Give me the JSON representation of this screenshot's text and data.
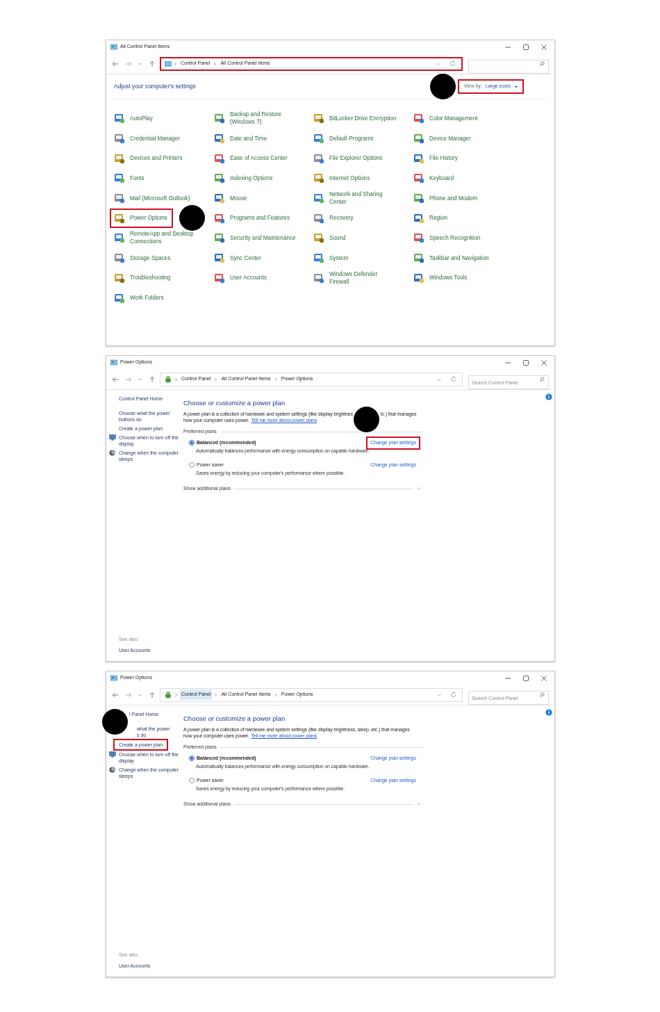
{
  "windows": [
    {
      "kind": "control_panel",
      "title": "All Control Panel Items",
      "breadcrumb": [
        {
          "label": "Control Panel",
          "hovered": false
        },
        {
          "label": "All Control Panel Items",
          "hovered": false
        }
      ],
      "address_highlighted": true,
      "heading": "Adjust your computer's settings",
      "view_by": {
        "label": "View by:",
        "value": "Large icons",
        "highlighted": true,
        "marker": true
      },
      "items": [
        {
          "label": "AutoPlay",
          "highlighted": false,
          "marker": false
        },
        {
          "label": "Backup and Restore\n(Windows 7)",
          "highlighted": false,
          "marker": false
        },
        {
          "label": "BitLocker Drive Encryption",
          "highlighted": false,
          "marker": false
        },
        {
          "label": "Color Management",
          "highlighted": false,
          "marker": false
        },
        {
          "label": "Credential Manager",
          "highlighted": false,
          "marker": false
        },
        {
          "label": "Date and Time",
          "highlighted": false,
          "marker": false
        },
        {
          "label": "Default Programs",
          "highlighted": false,
          "marker": false
        },
        {
          "label": "Device Manager",
          "highlighted": false,
          "marker": false
        },
        {
          "label": "Devices and Printers",
          "highlighted": false,
          "marker": false
        },
        {
          "label": "Ease of Access Center",
          "highlighted": false,
          "marker": false
        },
        {
          "label": "File Explorer Options",
          "highlighted": false,
          "marker": false
        },
        {
          "label": "File History",
          "highlighted": false,
          "marker": false
        },
        {
          "label": "Fonts",
          "highlighted": false,
          "marker": false
        },
        {
          "label": "Indexing Options",
          "highlighted": false,
          "marker": false
        },
        {
          "label": "Internet Options",
          "highlighted": false,
          "marker": false
        },
        {
          "label": "Keyboard",
          "highlighted": false,
          "marker": false
        },
        {
          "label": "Mail (Microsoft Outlook)",
          "highlighted": false,
          "marker": false
        },
        {
          "label": "Mouse",
          "highlighted": false,
          "marker": false
        },
        {
          "label": "Network and Sharing\nCenter",
          "highlighted": false,
          "marker": false
        },
        {
          "label": "Phone and Modem",
          "highlighted": false,
          "marker": false
        },
        {
          "label": "Power Options",
          "highlighted": true,
          "marker": true
        },
        {
          "label": "Programs and Features",
          "highlighted": false,
          "marker": false
        },
        {
          "label": "Recovery",
          "highlighted": false,
          "marker": false
        },
        {
          "label": "Region",
          "highlighted": false,
          "marker": false
        },
        {
          "label": "RemoteApp and Desktop\nConnections",
          "highlighted": false,
          "marker": false
        },
        {
          "label": "Security and Maintenance",
          "highlighted": false,
          "marker": false
        },
        {
          "label": "Sound",
          "highlighted": false,
          "marker": false
        },
        {
          "label": "Speech Recognition",
          "highlighted": false,
          "marker": false
        },
        {
          "label": "Storage Spaces",
          "highlighted": false,
          "marker": false
        },
        {
          "label": "Sync Center",
          "highlighted": false,
          "marker": false
        },
        {
          "label": "System",
          "highlighted": false,
          "marker": false
        },
        {
          "label": "Taskbar and Navigation",
          "highlighted": false,
          "marker": false
        },
        {
          "label": "Troubleshooting",
          "highlighted": false,
          "marker": false
        },
        {
          "label": "User Accounts",
          "highlighted": false,
          "marker": false
        },
        {
          "label": "Windows Defender\nFirewall",
          "highlighted": false,
          "marker": false
        },
        {
          "label": "Windows Tools",
          "highlighted": false,
          "marker": false
        },
        {
          "label": "Work Folders",
          "highlighted": false,
          "marker": false
        }
      ]
    },
    {
      "kind": "power_options",
      "title": "Power Options",
      "breadcrumb": [
        {
          "label": "Control Panel",
          "hovered": false
        },
        {
          "label": "All Control Panel Items",
          "hovered": false
        },
        {
          "label": "Power Options",
          "hovered": false
        }
      ],
      "address_highlighted": false,
      "search_placeholder": "Search Control Panel",
      "sidebar": [
        {
          "label": "Control Panel Home",
          "highlighted": false,
          "marker": false
        },
        {
          "label": "Choose what the power\nbuttons do",
          "highlighted": false,
          "marker": false
        },
        {
          "label": "Create a power plan",
          "highlighted": false,
          "marker": false
        },
        {
          "label": "Choose when to turn off the\ndisplay",
          "highlighted": false,
          "marker": false
        },
        {
          "label": "Change when the computer\nsleeps",
          "highlighted": false,
          "marker": false
        }
      ],
      "heading": "Choose or customize a power plan",
      "description": [
        [
          "A power plan is a collection of hardware and system settings (like display brightnes",
          "tc.) that manages"
        ],
        [
          "how your computer uses power."
        ]
      ],
      "description_link": "Tell me more about power plans",
      "section_label": "Preferred plans",
      "plans": [
        {
          "name": "Balanced (recommended)",
          "selected": true,
          "summary": "Automatically balances performance with energy consumption on capable hardware.",
          "action": "Change plan settings",
          "highlighted": true,
          "marker": true
        },
        {
          "name": "Power saver",
          "selected": false,
          "summary": "Saves energy by reducing your computer's performance where possible.",
          "action": "Change plan settings",
          "highlighted": false,
          "marker": false
        }
      ],
      "more_plans": "Show additional plans",
      "see_also": "See also",
      "see_also_link": "User Accounts"
    },
    {
      "kind": "power_options",
      "title": "Power Options",
      "breadcrumb": [
        {
          "label": "Control Panel",
          "hovered": true
        },
        {
          "label": "All Control Panel Items",
          "hovered": false
        },
        {
          "label": "Power Options",
          "hovered": false
        }
      ],
      "address_highlighted": false,
      "search_placeholder": "Search Control Panel",
      "sidebar": [
        {
          "label": "l Panel Home",
          "highlighted": false,
          "marker": true
        },
        {
          "label": "what the power\ns do",
          "highlighted": false,
          "marker": false
        },
        {
          "label": "Create a power plan",
          "highlighted": true,
          "marker": false
        },
        {
          "label": "Choose when to turn off the\ndisplay",
          "highlighted": false,
          "marker": false
        },
        {
          "label": "Change when the computer\nsleeps",
          "highlighted": false,
          "marker": false
        }
      ],
      "heading": "Choose or customize a power plan",
      "description": [
        [
          "A power plan is a collection of hardware and system settings (like display brightness, sleep, etc.) that manages"
        ],
        [
          "how your computer uses power."
        ]
      ],
      "description_link": "Tell me more about power plans",
      "section_label": "Preferred plans",
      "plans": [
        {
          "name": "Balanced (recommended)",
          "selected": true,
          "summary": "Automatically balances performance with energy consumption on capable hardware.",
          "action": "Change plan settings",
          "highlighted": false,
          "marker": false
        },
        {
          "name": "Power saver",
          "selected": false,
          "summary": "Saves energy by reducing your computer's performance where possible.",
          "action": "Change plan settings",
          "highlighted": false,
          "marker": false
        }
      ],
      "more_plans": "Show additional plans",
      "see_also": "See also",
      "see_also_link": "User Accounts"
    }
  ]
}
